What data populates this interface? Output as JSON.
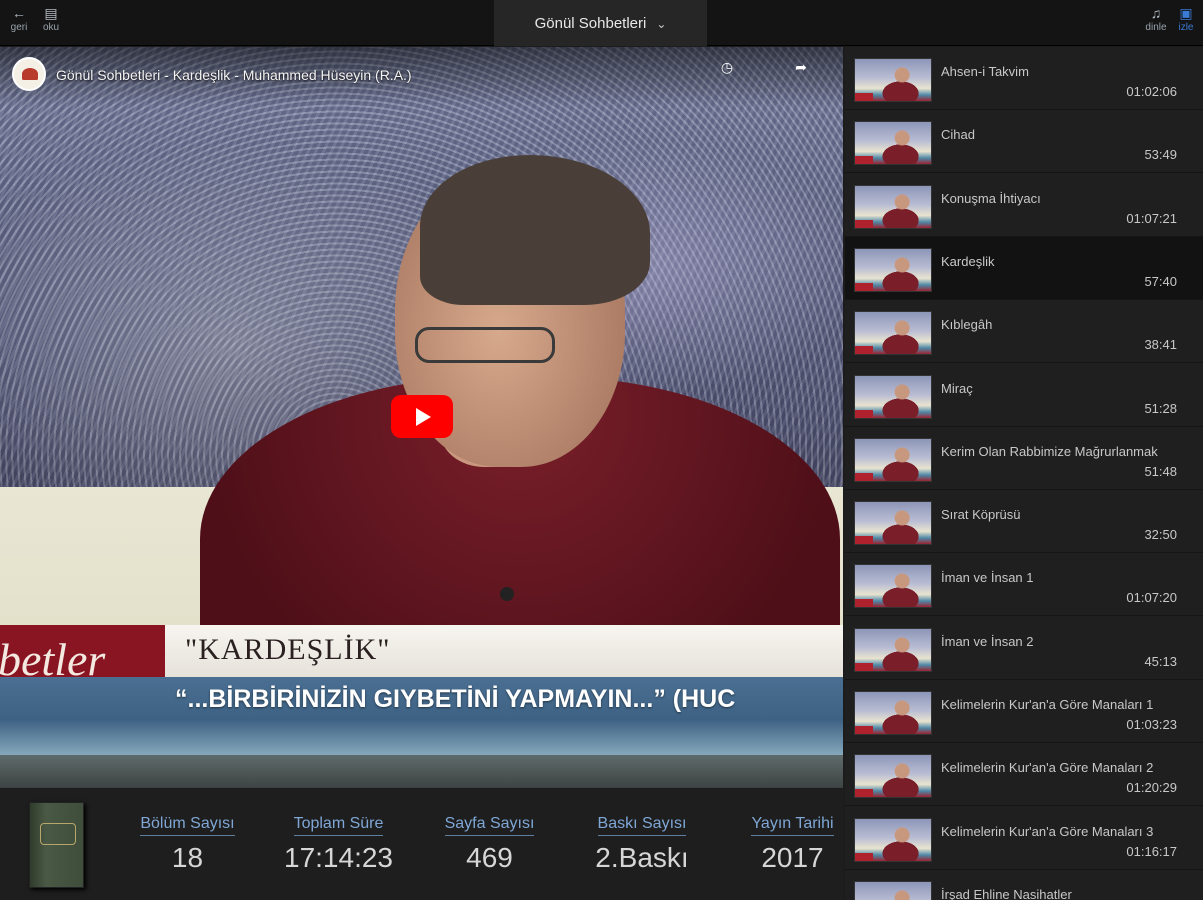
{
  "topbar": {
    "back_label": "geri",
    "read_label": "oku",
    "title": "Gönül Sohbetleri",
    "listen_label": "dinle",
    "list_label": "izle"
  },
  "video": {
    "title": "Gönül Sohbetleri - Kardeşlik - Muhammed Hüseyin (R.A.)",
    "lower_third_logo": "betler",
    "lower_third_title": "\"KARDEŞLİK\"",
    "lower_third_quote": "“...BİRBİRİNİZİN GIYBETİNİ YAPMAYIN...” (HUC"
  },
  "stats": [
    {
      "label": "Bölüm Sayısı",
      "value": "18"
    },
    {
      "label": "Toplam Süre",
      "value": "17:14:23"
    },
    {
      "label": "Sayfa Sayısı",
      "value": "469"
    },
    {
      "label": "Baskı Sayısı",
      "value": "2.Baskı"
    },
    {
      "label": "Yayın Tarihi",
      "value": "2017"
    }
  ],
  "playlist": [
    {
      "title": "Ahsen-i Takvim",
      "duration": "01:02:06"
    },
    {
      "title": "Cihad",
      "duration": "53:49"
    },
    {
      "title": "Konuşma İhtiyacı",
      "duration": "01:07:21"
    },
    {
      "title": "Kardeşlik",
      "duration": "57:40"
    },
    {
      "title": "Kıblegâh",
      "duration": "38:41"
    },
    {
      "title": "Miraç",
      "duration": "51:28"
    },
    {
      "title": "Kerim Olan Rabbimize Mağrurlanmak",
      "duration": "51:48"
    },
    {
      "title": "Sırat Köprüsü",
      "duration": "32:50"
    },
    {
      "title": "İman ve İnsan 1",
      "duration": "01:07:20"
    },
    {
      "title": "İman ve İnsan 2",
      "duration": "45:13"
    },
    {
      "title": "Kelimelerin Kur'an'a Göre Manaları 1",
      "duration": "01:03:23"
    },
    {
      "title": "Kelimelerin Kur'an'a Göre Manaları 2",
      "duration": "01:20:29"
    },
    {
      "title": "Kelimelerin Kur'an'a Göre Manaları 3",
      "duration": "01:16:17"
    },
    {
      "title": "İrşad Ehline Nasihatler",
      "duration": ""
    }
  ],
  "active_index": 3,
  "colors": {
    "accent": "#3a7bd5",
    "stat_label": "#7fa7d6",
    "youtube_red": "#ff0000",
    "brand_red": "#8a1522"
  }
}
